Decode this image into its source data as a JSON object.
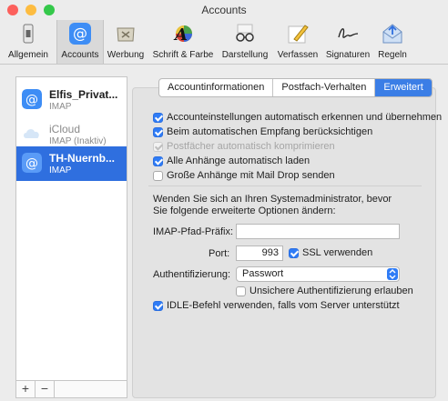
{
  "window": {
    "title": "Accounts"
  },
  "toolbar": {
    "items": [
      {
        "label": "Allgemein",
        "icon": "switch-icon"
      },
      {
        "label": "Accounts",
        "icon": "at-icon",
        "selected": true
      },
      {
        "label": "Werbung",
        "icon": "junk-mail-icon"
      },
      {
        "label": "Schrift & Farbe",
        "icon": "font-color-icon"
      },
      {
        "label": "Darstellung",
        "icon": "glasses-icon"
      },
      {
        "label": "Verfassen",
        "icon": "pencil-note-icon"
      },
      {
        "label": "Signaturen",
        "icon": "signature-icon"
      },
      {
        "label": "Regeln",
        "icon": "rules-envelope-icon"
      }
    ]
  },
  "sidebar": {
    "accounts": [
      {
        "name": "Elfis_Privat...",
        "type": "IMAP",
        "icon": "at-icon",
        "selected": false
      },
      {
        "name": "iCloud",
        "type": "IMAP (Inaktiv)",
        "icon": "icloud-icon",
        "selected": false
      },
      {
        "name": "TH-Nuernb...",
        "type": "IMAP",
        "icon": "at-icon",
        "selected": true
      }
    ],
    "add_label": "+",
    "remove_label": "−"
  },
  "tabs": [
    "Accountinformationen",
    "Postfach-Verhalten",
    "Erweitert"
  ],
  "active_tab": "Erweitert",
  "options": [
    {
      "label": "Accounteinstellungen automatisch erkennen und übernehmen",
      "state": "checked"
    },
    {
      "label": "Beim automatischen Empfang berücksichtigen",
      "state": "checked"
    },
    {
      "label": "Postfächer automatisch komprimieren",
      "state": "disabled"
    },
    {
      "label": "Alle Anhänge automatisch laden",
      "state": "checked"
    },
    {
      "label": "Große Anhänge mit Mail Drop senden",
      "state": "unchecked"
    }
  ],
  "advanced": {
    "note": "Wenden Sie sich an Ihren Systemadministrator, bevor Sie folgende erweiterte Optionen ändern:",
    "imap_prefix_label": "IMAP-Pfad-Präfix:",
    "imap_prefix_value": "",
    "port_label": "Port:",
    "port_value": "993",
    "ssl_label": "SSL verwenden",
    "auth_label": "Authentifizierung:",
    "auth_value": "Passwort",
    "insecure_label": "Unsichere Authentifizierung erlauben",
    "idle_label": "IDLE-Befehl verwenden, falls vom Server unterstützt"
  },
  "colors": {
    "accent": "#2f7cf6",
    "selection": "#2f6fdf"
  }
}
